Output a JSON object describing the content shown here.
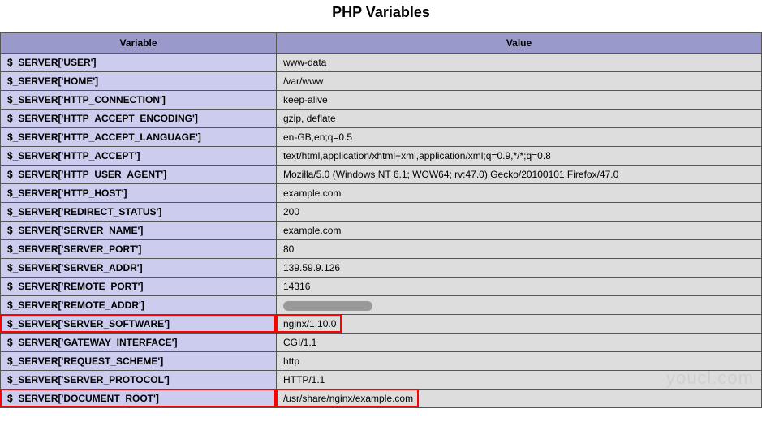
{
  "title": "PHP Variables",
  "headers": {
    "variable": "Variable",
    "value": "Value"
  },
  "rows": [
    {
      "var": "$_SERVER['USER']",
      "val": "www-data"
    },
    {
      "var": "$_SERVER['HOME']",
      "val": "/var/www"
    },
    {
      "var": "$_SERVER['HTTP_CONNECTION']",
      "val": "keep-alive"
    },
    {
      "var": "$_SERVER['HTTP_ACCEPT_ENCODING']",
      "val": "gzip, deflate"
    },
    {
      "var": "$_SERVER['HTTP_ACCEPT_LANGUAGE']",
      "val": "en-GB,en;q=0.5"
    },
    {
      "var": "$_SERVER['HTTP_ACCEPT']",
      "val": "text/html,application/xhtml+xml,application/xml;q=0.9,*/*;q=0.8"
    },
    {
      "var": "$_SERVER['HTTP_USER_AGENT']",
      "val": "Mozilla/5.0 (Windows NT 6.1; WOW64; rv:47.0) Gecko/20100101 Firefox/47.0"
    },
    {
      "var": "$_SERVER['HTTP_HOST']",
      "val": "example.com"
    },
    {
      "var": "$_SERVER['REDIRECT_STATUS']",
      "val": "200"
    },
    {
      "var": "$_SERVER['SERVER_NAME']",
      "val": "example.com"
    },
    {
      "var": "$_SERVER['SERVER_PORT']",
      "val": "80"
    },
    {
      "var": "$_SERVER['SERVER_ADDR']",
      "val": "139.59.9.126"
    },
    {
      "var": "$_SERVER['REMOTE_PORT']",
      "val": "14316"
    },
    {
      "var": "$_SERVER['REMOTE_ADDR']",
      "val": "",
      "redacted": true
    },
    {
      "var": "$_SERVER['SERVER_SOFTWARE']",
      "val": "nginx/1.10.0",
      "highlight": true
    },
    {
      "var": "$_SERVER['GATEWAY_INTERFACE']",
      "val": "CGI/1.1"
    },
    {
      "var": "$_SERVER['REQUEST_SCHEME']",
      "val": "http"
    },
    {
      "var": "$_SERVER['SERVER_PROTOCOL']",
      "val": "HTTP/1.1"
    },
    {
      "var": "$_SERVER['DOCUMENT_ROOT']",
      "val": "/usr/share/nginx/example.com",
      "highlight": true
    }
  ],
  "watermark": "youcl.com"
}
